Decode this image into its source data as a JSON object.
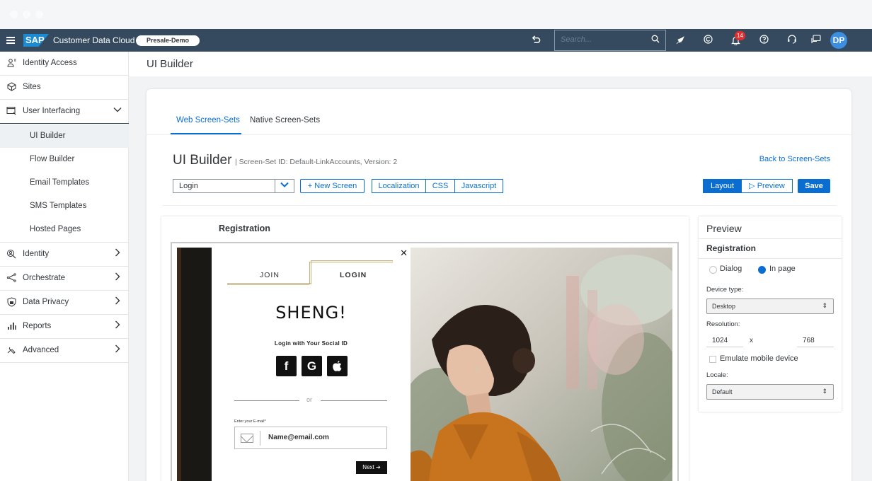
{
  "shell": {
    "product_name": "Customer Data Cloud",
    "logo_text": "SAP",
    "environment": "Presale-Demo",
    "search_placeholder": "Search...",
    "notification_count": "14",
    "avatar_initials": "DP"
  },
  "sidebar": {
    "items": [
      {
        "label": "Identity Access",
        "icon": "identity-access-icon"
      },
      {
        "label": "Sites",
        "icon": "sites-icon"
      },
      {
        "label": "User Interfacing",
        "icon": "user-interfacing-icon",
        "expanded": true
      },
      {
        "label": "Identity",
        "icon": "identity-icon"
      },
      {
        "label": "Orchestrate",
        "icon": "orchestrate-icon"
      },
      {
        "label": "Data Privacy",
        "icon": "data-privacy-icon"
      },
      {
        "label": "Reports",
        "icon": "reports-icon"
      },
      {
        "label": "Advanced",
        "icon": "advanced-icon"
      }
    ],
    "sub_items": [
      {
        "label": "UI Builder",
        "selected": true
      },
      {
        "label": "Flow Builder"
      },
      {
        "label": "Email Templates"
      },
      {
        "label": "SMS Templates"
      },
      {
        "label": "Hosted Pages"
      }
    ]
  },
  "page": {
    "header_title": "UI Builder",
    "tabs": [
      {
        "label": "Web Screen-Sets",
        "active": true
      },
      {
        "label": "Native Screen-Sets"
      }
    ],
    "builder_title": "UI Builder",
    "builder_meta": "Screen-Set ID: Default-LinkAccounts,  Version: 2",
    "back_link": "Back to Screen-Sets",
    "screen_select_value": "Login",
    "new_screen_label": "+ New Screen",
    "code_tabs": [
      "Localization",
      "CSS",
      "Javascript"
    ],
    "layout_label": "Layout",
    "preview_label": "Preview",
    "save_label": "Save"
  },
  "canvas": {
    "title": "Registration",
    "form": {
      "tab_join": "JOIN",
      "tab_login": "LOGIN",
      "brand": "SHENG!",
      "social_caption": "Login with Your Social ID",
      "social": [
        "f",
        "G",
        ""
      ],
      "or_text": "or",
      "email_label": "Enter your E-mail*",
      "email_value": "Name@email.com",
      "next_label": "Next"
    }
  },
  "preview_panel": {
    "title": "Preview",
    "screen": "Registration",
    "mode_dialog": "Dialog",
    "mode_in_page": "In page",
    "device_label": "Device type:",
    "device_value": "Desktop",
    "resolution_label": "Resolution:",
    "width": "1024",
    "times": "x",
    "height": "768",
    "emulate_label": "Emulate mobile device",
    "locale_label": "Locale:",
    "locale_value": "Default"
  },
  "colors": {
    "shell_bg": "#354a5f",
    "accent": "#0a6ed1",
    "badge_red": "#e02f2f",
    "photo_jacket": "#c8741e"
  }
}
